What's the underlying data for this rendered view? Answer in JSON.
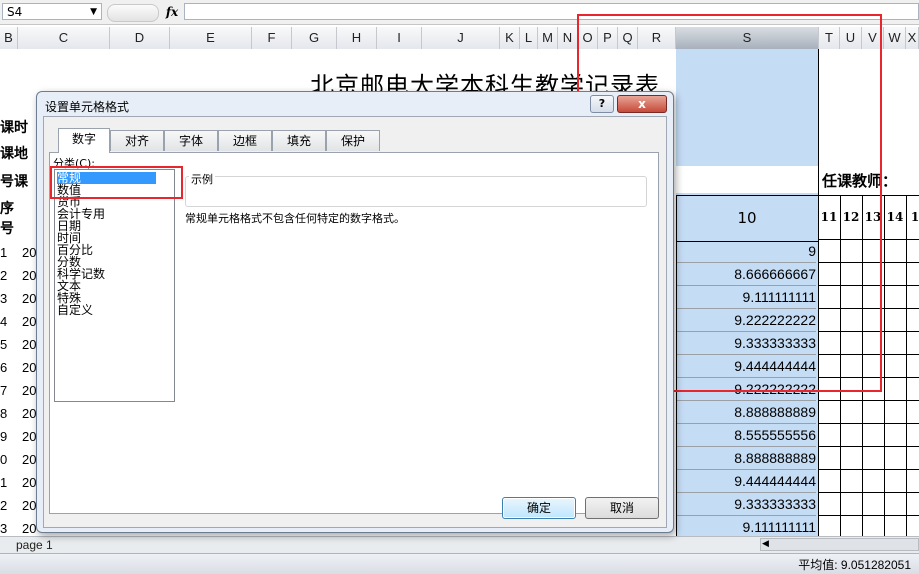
{
  "formula_bar": {
    "name_box": "S4",
    "fx": "fx"
  },
  "columns": [
    "B",
    "C",
    "D",
    "E",
    "F",
    "G",
    "H",
    "I",
    "J",
    "K",
    "L",
    "M",
    "N",
    "O",
    "P",
    "Q",
    "R",
    "S",
    "T",
    "U",
    "V",
    "W",
    "X"
  ],
  "sheet": {
    "title": "北京邮电大学本科生教学记录表",
    "left_labels": [
      "课时",
      "课地",
      "号课",
      "序",
      "号"
    ],
    "row_numbers": [
      "1",
      "2",
      "3",
      "4",
      "5",
      "6",
      "7",
      "8",
      "9",
      "0",
      "1",
      "2",
      "3"
    ],
    "row_prefix": "20",
    "teacher_label": "任课教师：",
    "s_header": "10",
    "week_headers": [
      "11",
      "12",
      "13",
      "14",
      "1"
    ],
    "s_values": [
      "9",
      "8.666666667",
      "9.111111111",
      "9.222222222",
      "9.333333333",
      "9.444444444",
      "9.222222222",
      "8.888888889",
      "8.555555556",
      "8.888888889",
      "9.444444444",
      "9.333333333",
      "9.111111111"
    ]
  },
  "sheet_tab": "page 1",
  "status": {
    "average": "平均值: 9.051282051"
  },
  "dialog": {
    "title": "设置单元格格式",
    "help": "?",
    "close": "x",
    "tabs": [
      "数字",
      "对齐",
      "字体",
      "边框",
      "填充",
      "保护"
    ],
    "category_label": "分类(C):",
    "categories": [
      "常规",
      "数值",
      "货币",
      "会计专用",
      "日期",
      "时间",
      "百分比",
      "分数",
      "科学记数",
      "文本",
      "特殊",
      "自定义"
    ],
    "sample_label": "示例",
    "description": "常规单元格格式不包含任何特定的数字格式。",
    "ok": "确定",
    "cancel": "取消"
  }
}
